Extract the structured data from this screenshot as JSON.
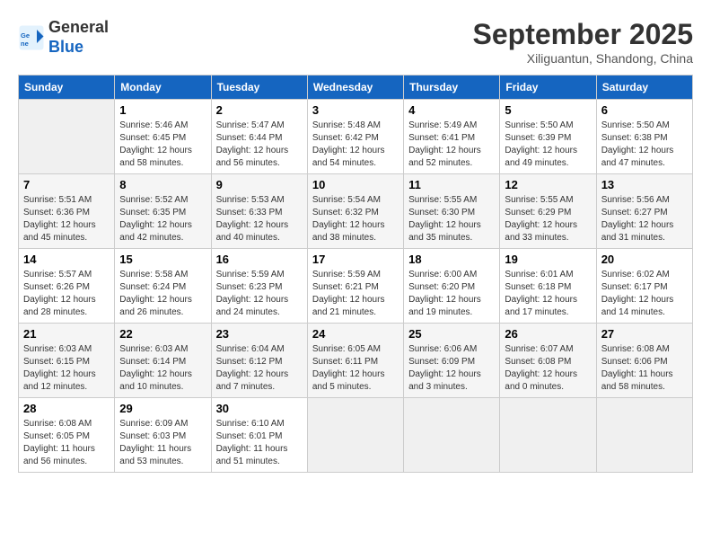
{
  "header": {
    "logo_line1": "General",
    "logo_line2": "Blue",
    "month_title": "September 2025",
    "subtitle": "Xiliguantun, Shandong, China"
  },
  "days_of_week": [
    "Sunday",
    "Monday",
    "Tuesday",
    "Wednesday",
    "Thursday",
    "Friday",
    "Saturday"
  ],
  "weeks": [
    [
      {
        "day": "",
        "info": ""
      },
      {
        "day": "1",
        "info": "Sunrise: 5:46 AM\nSunset: 6:45 PM\nDaylight: 12 hours\nand 58 minutes."
      },
      {
        "day": "2",
        "info": "Sunrise: 5:47 AM\nSunset: 6:44 PM\nDaylight: 12 hours\nand 56 minutes."
      },
      {
        "day": "3",
        "info": "Sunrise: 5:48 AM\nSunset: 6:42 PM\nDaylight: 12 hours\nand 54 minutes."
      },
      {
        "day": "4",
        "info": "Sunrise: 5:49 AM\nSunset: 6:41 PM\nDaylight: 12 hours\nand 52 minutes."
      },
      {
        "day": "5",
        "info": "Sunrise: 5:50 AM\nSunset: 6:39 PM\nDaylight: 12 hours\nand 49 minutes."
      },
      {
        "day": "6",
        "info": "Sunrise: 5:50 AM\nSunset: 6:38 PM\nDaylight: 12 hours\nand 47 minutes."
      }
    ],
    [
      {
        "day": "7",
        "info": "Sunrise: 5:51 AM\nSunset: 6:36 PM\nDaylight: 12 hours\nand 45 minutes."
      },
      {
        "day": "8",
        "info": "Sunrise: 5:52 AM\nSunset: 6:35 PM\nDaylight: 12 hours\nand 42 minutes."
      },
      {
        "day": "9",
        "info": "Sunrise: 5:53 AM\nSunset: 6:33 PM\nDaylight: 12 hours\nand 40 minutes."
      },
      {
        "day": "10",
        "info": "Sunrise: 5:54 AM\nSunset: 6:32 PM\nDaylight: 12 hours\nand 38 minutes."
      },
      {
        "day": "11",
        "info": "Sunrise: 5:55 AM\nSunset: 6:30 PM\nDaylight: 12 hours\nand 35 minutes."
      },
      {
        "day": "12",
        "info": "Sunrise: 5:55 AM\nSunset: 6:29 PM\nDaylight: 12 hours\nand 33 minutes."
      },
      {
        "day": "13",
        "info": "Sunrise: 5:56 AM\nSunset: 6:27 PM\nDaylight: 12 hours\nand 31 minutes."
      }
    ],
    [
      {
        "day": "14",
        "info": "Sunrise: 5:57 AM\nSunset: 6:26 PM\nDaylight: 12 hours\nand 28 minutes."
      },
      {
        "day": "15",
        "info": "Sunrise: 5:58 AM\nSunset: 6:24 PM\nDaylight: 12 hours\nand 26 minutes."
      },
      {
        "day": "16",
        "info": "Sunrise: 5:59 AM\nSunset: 6:23 PM\nDaylight: 12 hours\nand 24 minutes."
      },
      {
        "day": "17",
        "info": "Sunrise: 5:59 AM\nSunset: 6:21 PM\nDaylight: 12 hours\nand 21 minutes."
      },
      {
        "day": "18",
        "info": "Sunrise: 6:00 AM\nSunset: 6:20 PM\nDaylight: 12 hours\nand 19 minutes."
      },
      {
        "day": "19",
        "info": "Sunrise: 6:01 AM\nSunset: 6:18 PM\nDaylight: 12 hours\nand 17 minutes."
      },
      {
        "day": "20",
        "info": "Sunrise: 6:02 AM\nSunset: 6:17 PM\nDaylight: 12 hours\nand 14 minutes."
      }
    ],
    [
      {
        "day": "21",
        "info": "Sunrise: 6:03 AM\nSunset: 6:15 PM\nDaylight: 12 hours\nand 12 minutes."
      },
      {
        "day": "22",
        "info": "Sunrise: 6:03 AM\nSunset: 6:14 PM\nDaylight: 12 hours\nand 10 minutes."
      },
      {
        "day": "23",
        "info": "Sunrise: 6:04 AM\nSunset: 6:12 PM\nDaylight: 12 hours\nand 7 minutes."
      },
      {
        "day": "24",
        "info": "Sunrise: 6:05 AM\nSunset: 6:11 PM\nDaylight: 12 hours\nand 5 minutes."
      },
      {
        "day": "25",
        "info": "Sunrise: 6:06 AM\nSunset: 6:09 PM\nDaylight: 12 hours\nand 3 minutes."
      },
      {
        "day": "26",
        "info": "Sunrise: 6:07 AM\nSunset: 6:08 PM\nDaylight: 12 hours\nand 0 minutes."
      },
      {
        "day": "27",
        "info": "Sunrise: 6:08 AM\nSunset: 6:06 PM\nDaylight: 11 hours\nand 58 minutes."
      }
    ],
    [
      {
        "day": "28",
        "info": "Sunrise: 6:08 AM\nSunset: 6:05 PM\nDaylight: 11 hours\nand 56 minutes."
      },
      {
        "day": "29",
        "info": "Sunrise: 6:09 AM\nSunset: 6:03 PM\nDaylight: 11 hours\nand 53 minutes."
      },
      {
        "day": "30",
        "info": "Sunrise: 6:10 AM\nSunset: 6:01 PM\nDaylight: 11 hours\nand 51 minutes."
      },
      {
        "day": "",
        "info": ""
      },
      {
        "day": "",
        "info": ""
      },
      {
        "day": "",
        "info": ""
      },
      {
        "day": "",
        "info": ""
      }
    ]
  ]
}
